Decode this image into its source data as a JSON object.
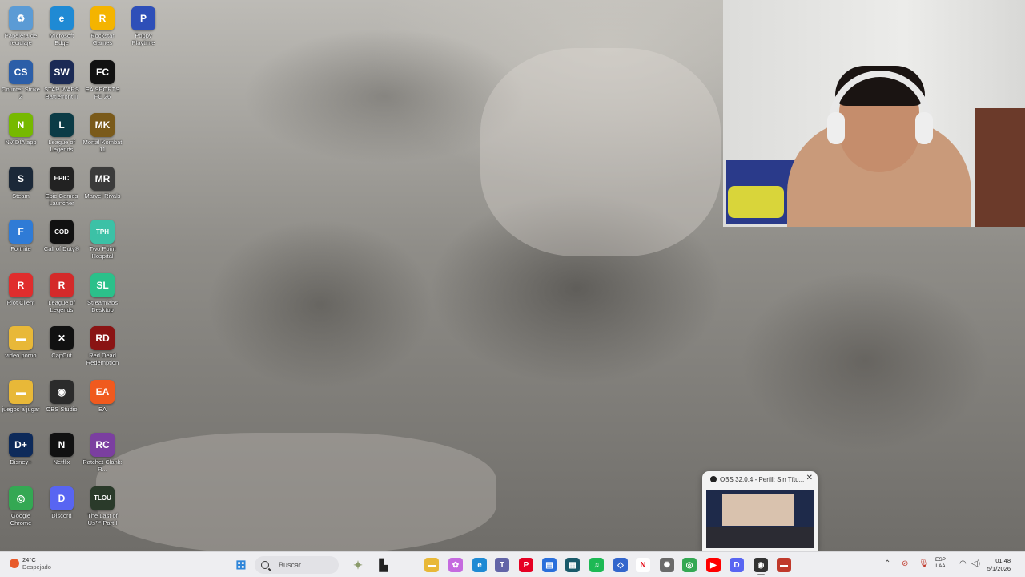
{
  "desktop_icons": [
    {
      "label": "Papelera de reciclaje",
      "icon": "recycle-bin-icon",
      "color": "#5b9bd5",
      "glyph": "♻"
    },
    {
      "label": "Microsoft Edge",
      "icon": "edge-icon",
      "color": "#1f8ad4",
      "glyph": "e"
    },
    {
      "label": "Rockstar Games",
      "icon": "rockstar-icon",
      "color": "#f4b400",
      "glyph": "R"
    },
    {
      "label": "Poppy Playtime",
      "icon": "poppy-playtime-icon",
      "color": "#2e4fb8",
      "glyph": "P"
    },
    {
      "label": "Counter Strike 2",
      "icon": "counter-strike-icon",
      "color": "#2b5ea8",
      "glyph": "CS"
    },
    {
      "label": "STAR WARS Battlefront II",
      "icon": "star-wars-icon",
      "color": "#1b2a55",
      "glyph": "SW"
    },
    {
      "label": "EA SPORTS FC 26",
      "icon": "ea-fc-icon",
      "color": "#111",
      "glyph": "FC"
    },
    {
      "label": "NVIDIA app",
      "icon": "nvidia-icon",
      "color": "#76b900",
      "glyph": "N"
    },
    {
      "label": "League of Legends",
      "icon": "league-of-legends-icon",
      "color": "#0b3b46",
      "glyph": "L"
    },
    {
      "label": "Mortal Kombat 11",
      "icon": "mortal-kombat-icon",
      "color": "#7a5a1a",
      "glyph": "MK"
    },
    {
      "label": "Steam",
      "icon": "steam-icon",
      "color": "#1b2838",
      "glyph": "S"
    },
    {
      "label": "Epic Games Launcher",
      "icon": "epic-games-icon",
      "color": "#222",
      "glyph": "EPIC"
    },
    {
      "label": "Marvel Rivals",
      "icon": "marvel-rivals-icon",
      "color": "#3b3b3b",
      "glyph": "MR"
    },
    {
      "label": "Fortnite",
      "icon": "fortnite-icon",
      "color": "#2f7bd6",
      "glyph": "F"
    },
    {
      "label": "Call of Duty®",
      "icon": "call-of-duty-icon",
      "color": "#111",
      "glyph": "COD"
    },
    {
      "label": "Two Point Hospital",
      "icon": "two-point-hospital-icon",
      "color": "#3cc1a6",
      "glyph": "TPH"
    },
    {
      "label": "Riot Client",
      "icon": "riot-client-icon",
      "color": "#e02d2d",
      "glyph": "R"
    },
    {
      "label": "League of Legends",
      "icon": "league-of-legends-icon",
      "color": "#d42a2a",
      "glyph": "R"
    },
    {
      "label": "Streamlabs Desktop",
      "icon": "streamlabs-icon",
      "color": "#2bc08a",
      "glyph": "SL"
    },
    {
      "label": "video porno",
      "icon": "folder-icon",
      "color": "#e8b838",
      "glyph": "▬"
    },
    {
      "label": "CapCut",
      "icon": "capcut-icon",
      "color": "#111",
      "glyph": "✕"
    },
    {
      "label": "Red Dead Redemption",
      "icon": "red-dead-icon",
      "color": "#8a1414",
      "glyph": "RD"
    },
    {
      "label": "juegos a jugar",
      "icon": "folder-icon",
      "color": "#e8b838",
      "glyph": "▬"
    },
    {
      "label": "OBS Studio",
      "icon": "obs-icon",
      "color": "#2b2b2b",
      "glyph": "◉"
    },
    {
      "label": "EA",
      "icon": "ea-icon",
      "color": "#f05a1e",
      "glyph": "EA"
    },
    {
      "label": "Disney+",
      "icon": "disney-plus-icon",
      "color": "#0d2a5a",
      "glyph": "D+"
    },
    {
      "label": "Netflix",
      "icon": "netflix-icon",
      "color": "#111",
      "glyph": "N"
    },
    {
      "label": "Ratchet Clank: R...",
      "icon": "ratchet-clank-icon",
      "color": "#7b3fa0",
      "glyph": "RC"
    },
    {
      "label": "Google Chrome",
      "icon": "chrome-icon",
      "color": "#34a853",
      "glyph": "◎"
    },
    {
      "label": "Discord",
      "icon": "discord-icon",
      "color": "#5865f2",
      "glyph": "D"
    },
    {
      "label": "The Last of Us™ Part I",
      "icon": "last-of-us-icon",
      "color": "#2a3a2a",
      "glyph": "TLOU"
    }
  ],
  "obs_preview": {
    "title": "OBS 32.0.4 - Perfil: Sin Títu...",
    "close": "✕"
  },
  "taskbar": {
    "weather_temp": "24°C",
    "weather_desc": "Despejado",
    "search_placeholder": "Buscar",
    "apps": [
      {
        "icon": "windows-start-icon",
        "color": "#2f86d9",
        "glyph": "⊞"
      },
      {
        "icon": "game-icon",
        "color": "#8a9a6a",
        "glyph": "✦"
      },
      {
        "icon": "terminal-icon",
        "color": "#222",
        "glyph": "▙"
      },
      {
        "icon": "file-explorer-icon",
        "color": "#e8b838",
        "glyph": "▬"
      },
      {
        "icon": "copilot-icon",
        "color": "#c56adf",
        "glyph": "✿"
      },
      {
        "icon": "edge-icon",
        "color": "#1f8ad4",
        "glyph": "e"
      },
      {
        "icon": "teams-icon",
        "color": "#6264a7",
        "glyph": "T"
      },
      {
        "icon": "pinterest-icon",
        "color": "#e60023",
        "glyph": "P"
      },
      {
        "icon": "store-icon",
        "color": "#2a6fdb",
        "glyph": "▤"
      },
      {
        "icon": "photos-icon",
        "color": "#1a5a6a",
        "glyph": "▦"
      },
      {
        "icon": "spotify-icon",
        "color": "#1db954",
        "glyph": "♫"
      },
      {
        "icon": "vscode-icon",
        "color": "#3366cc",
        "glyph": "◇"
      },
      {
        "icon": "netflix-icon",
        "color": "#ffffff",
        "glyph": "N"
      },
      {
        "icon": "game-controller-icon",
        "color": "#6a6a6a",
        "glyph": "✺"
      },
      {
        "icon": "chrome-icon",
        "color": "#34a853",
        "glyph": "◎"
      },
      {
        "icon": "youtube-icon",
        "color": "#ff0000",
        "glyph": "▶"
      },
      {
        "icon": "discord-icon",
        "color": "#5865f2",
        "glyph": "D"
      },
      {
        "icon": "obs-icon",
        "color": "#333",
        "glyph": "◉"
      },
      {
        "icon": "recording-app-icon",
        "color": "#c0392b",
        "glyph": "▬"
      }
    ],
    "lang_top": "ESP",
    "lang_bottom": "LAA",
    "time": "01:48",
    "date": "5/1/2026"
  },
  "colors": {
    "accent": "#2f86d9",
    "taskbar_bg": "#eeeef1"
  }
}
